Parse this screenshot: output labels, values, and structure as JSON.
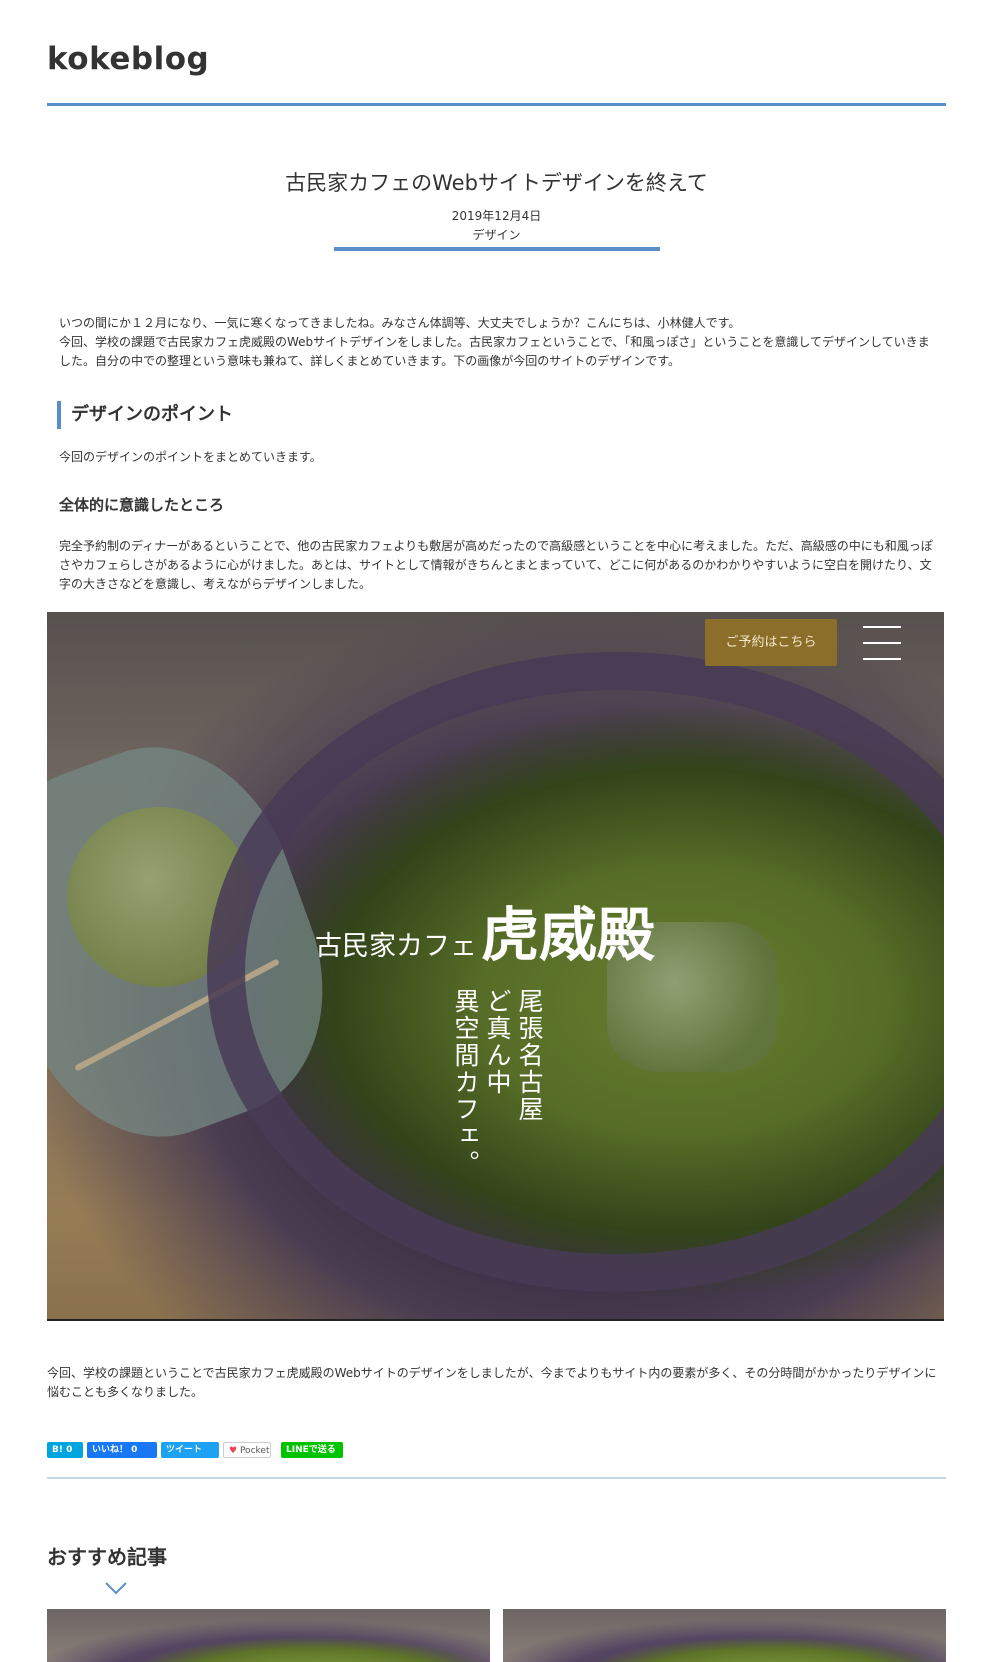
{
  "site": {
    "title": "kokeblog"
  },
  "article": {
    "title": "古民家カフェのWebサイトデザインを終えて",
    "date": "2019年12月4日",
    "category": "デザイン",
    "intro_line1": "いつの間にか１２月になり、一気に寒くなってきましたね。みなさん体調等、大丈夫でしょうか？こんにちは、小林健人です。",
    "intro_line2": "今回、学校の課題で古民家カフェ虎威殿のWebサイトデザインをしました。古民家カフェということで、「和風っぽさ」ということを意識してデザインしていきました。自分の中での整理という意味も兼ねて、詳しくまとめていきます。下の画像が今回のサイトのデザインです。",
    "h2": "デザインのポイント",
    "p2": "今回のデザインのポイントをまとめていきます。",
    "h3": "全体的に意識したところ",
    "p3": "完全予約制のディナーがあるということで、他の古民家カフェよりも敷居が高めだったので高級感ということを中心に考えました。ただ、高級感の中にも和風っぽさやカフェらしさがあるように心がけました。あとは、サイトとして情報がきちんとまとまっていて、どこに何があるのかわかりやすいように空白を開けたり、文字の大きさなどを意識し、考えながらデザインしました。",
    "p4": "今回、学校の課題ということで古民家カフェ虎威殿のWebサイトのデザインをしましたが、今までよりもサイト内の要素が多く、その分時間がかかったりデザインに悩むことも多くなりました。"
  },
  "hero": {
    "reserve_label": "ご予約はこちら",
    "brand_small": "古民家カフェ",
    "brand_big": "虎威殿",
    "tagline": [
      "尾張名古屋",
      "ど真ん中",
      "異空間カフェ。"
    ],
    "icon": "hamburger-menu-icon"
  },
  "share": {
    "hatena": "B! 0",
    "like": "いいね！ 0",
    "tweet": "ツイート",
    "pocket": "Pocket",
    "line": "LINEで送る"
  },
  "recommend": {
    "title": "おすすめ記事",
    "icon": "chevron-down-icon"
  },
  "colors": {
    "accent": "#5b8dc9",
    "reserve_button": "#8a6e2a",
    "share_rule": "#c3d7e6"
  }
}
